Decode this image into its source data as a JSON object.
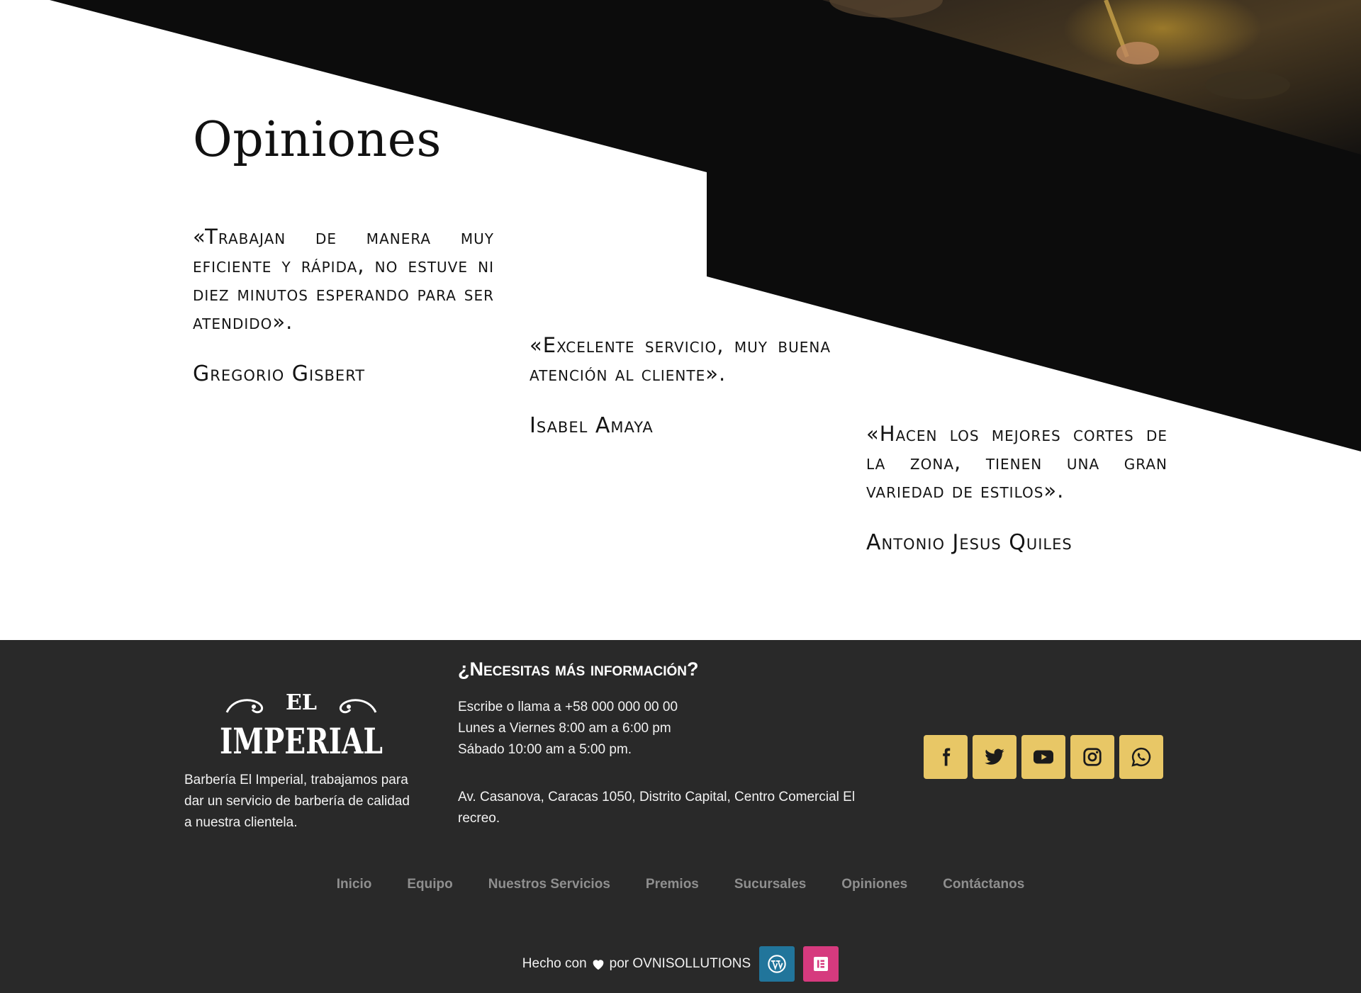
{
  "section": {
    "title": "Opiniones"
  },
  "testimonials": [
    {
      "quote": "«Trabajan de manera muy eficiente y rápida, no estuve ni diez minutos esperando para ser atendido».",
      "author": "Gregorio Gisbert"
    },
    {
      "quote": "«Excelente servicio, muy buena atención al cliente».",
      "author": "Isabel Amaya"
    },
    {
      "quote": "«Hacen los mejores cortes de la zona, tienen una gran variedad de estilos».",
      "author": "Antonio Jesus Quiles"
    }
  ],
  "footer": {
    "logo_small": "EL",
    "logo_big": "IMPERIAL",
    "about": "Barbería El Imperial, trabajamos para dar un servicio de barbería de calidad a nuestra clientela.",
    "info_title": "¿Necesitas más información?",
    "info_lines": [
      "Escribe o llama a +58 000 000 00 00",
      "Lunes a Viernes 8:00 am a 6:00 pm",
      "Sábado 10:00 am a 5:00 pm."
    ],
    "address": "Av. Casanova, Caracas 1050, Distrito Capital, Centro Comercial El recreo.",
    "social": [
      "facebook-icon",
      "twitter-icon",
      "youtube-icon",
      "instagram-icon",
      "whatsapp-icon"
    ],
    "nav": [
      "Inicio",
      "Equipo",
      "Nuestros Servicios",
      "Premios",
      "Sucursales",
      "Opiniones",
      "Contáctanos"
    ],
    "credit_prefix": "Hecho con",
    "credit_suffix": "por OVNISOLLUTIONS",
    "badges": [
      "wordpress-icon",
      "elementor-icon"
    ]
  },
  "colors": {
    "accent": "#e8c766",
    "footer_bg": "#292929",
    "dark": "#0c0c0c",
    "nav_text": "#8f8f8f",
    "wordpress": "#21759b",
    "elementor": "#d63a7e"
  }
}
